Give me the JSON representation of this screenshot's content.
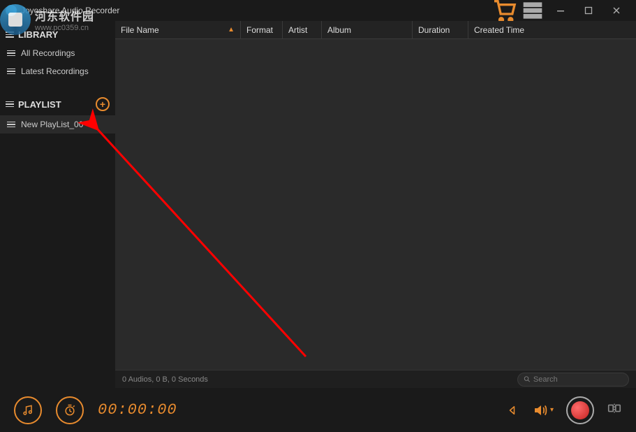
{
  "app": {
    "title": "Joyoshare Audio Recorder"
  },
  "watermark": {
    "text": "河东软件园",
    "url": "www.pc0359.cn"
  },
  "sidebar": {
    "library_label": "LIBRARY",
    "all_recordings": "All Recordings",
    "latest_recordings": "Latest Recordings",
    "playlist_label": "PLAYLIST",
    "playlists": [
      {
        "name": "New PlayList_00"
      }
    ]
  },
  "columns": {
    "filename": "File Name",
    "format": "Format",
    "artist": "Artist",
    "album": "Album",
    "duration": "Duration",
    "created": "Created Time"
  },
  "status": {
    "summary": "0 Audios, 0 B, 0 Seconds"
  },
  "search": {
    "placeholder": "Search"
  },
  "player": {
    "time": "00:00:00"
  }
}
